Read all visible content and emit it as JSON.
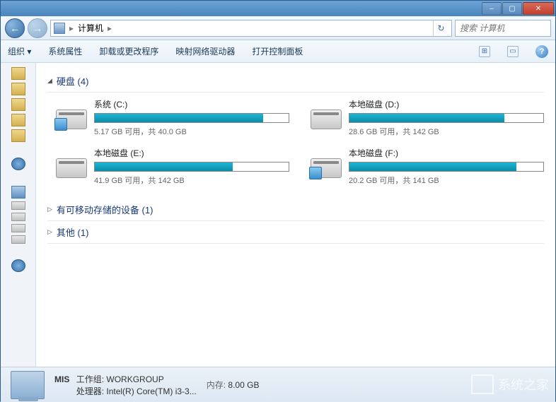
{
  "titlebar": {
    "min": "–",
    "max": "▢",
    "close": "✕"
  },
  "nav": {
    "back": "←",
    "fwd": "→",
    "path_label": "计算机",
    "sep": "▸",
    "refresh": "↻",
    "search_placeholder": "搜索 计算机"
  },
  "toolbar": {
    "organize": "组织 ▾",
    "properties": "系统属性",
    "uninstall": "卸载或更改程序",
    "map_drive": "映射网络驱动器",
    "control_panel": "打开控制面板",
    "view_icon": "⊞",
    "pane_icon": "▭",
    "help": "?"
  },
  "sections": {
    "drives": {
      "tri": "◢",
      "label": "硬盘 (4)"
    },
    "removable": {
      "tri": "▷",
      "label": "有可移动存储的设备 (1)"
    },
    "other": {
      "tri": "▷",
      "label": "其他 (1)"
    }
  },
  "drives": [
    {
      "name": "系统 (C:)",
      "free": "5.17 GB 可用，共 40.0 GB",
      "fill": 87,
      "badge": true
    },
    {
      "name": "本地磁盘 (D:)",
      "free": "28.6 GB 可用，共 142 GB",
      "fill": 80
    },
    {
      "name": "本地磁盘 (E:)",
      "free": "41.9 GB 可用，共 142 GB",
      "fill": 71
    },
    {
      "name": "本地磁盘 (F:)",
      "free": "20.2 GB 可用，共 141 GB",
      "fill": 86,
      "badge": true
    }
  ],
  "status": {
    "name": "MIS",
    "workgroup_label": "工作组:",
    "workgroup": "WORKGROUP",
    "cpu_label": "处理器:",
    "cpu": "Intel(R) Core(TM) i3-3...",
    "mem_label": "内存:",
    "mem": "8.00 GB"
  },
  "watermark": "系统之家"
}
